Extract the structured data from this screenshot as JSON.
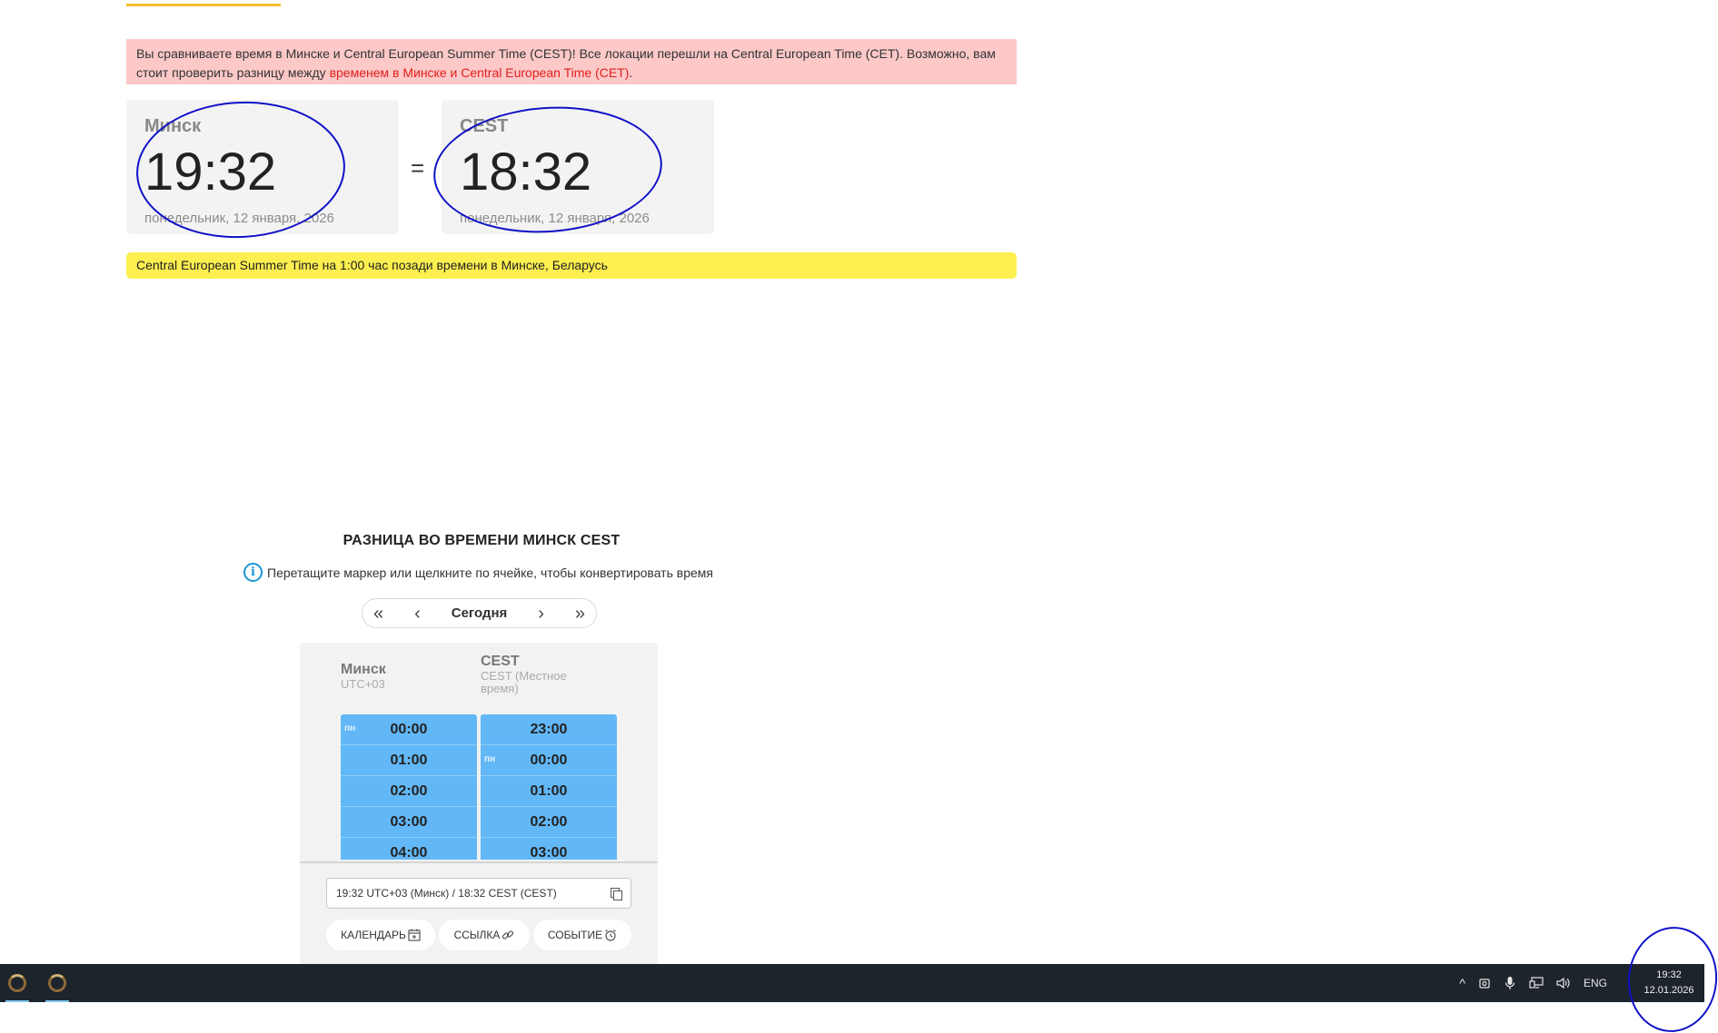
{
  "warning": {
    "text": "Вы сравниваете время в Минске и Central European Summer Time (CEST)! Все локации перешли на Central European Time (CET). Возможно, вам стоит проверить разницу между ",
    "link": "временем в Минске и Central European Time (CET)",
    "tail": "."
  },
  "cards": {
    "left": {
      "city": "Минск",
      "time": "19:32",
      "date": "понедельник, 12 января, 2026"
    },
    "equals": "=",
    "right": {
      "city": "CEST",
      "time": "18:32",
      "date": "понедельник, 12 января, 2026"
    }
  },
  "summary": "Central European Summer Time на 1:00 час позади времени в Минске, Беларусь",
  "converter": {
    "title": "РАЗНИЦА ВО ВРЕМЕНИ МИНСК CEST",
    "hint": "Перетащите маркер или щелкните по ячейке, чтобы конвертировать время",
    "nav": {
      "first": "«",
      "prev": "‹",
      "today": "Сегодня",
      "next": "›",
      "last": "»"
    },
    "col1": {
      "name": "Минск",
      "sub": "UTC+03",
      "cells": [
        {
          "day": "пн",
          "time": "00:00"
        },
        {
          "day": "",
          "time": "01:00"
        },
        {
          "day": "",
          "time": "02:00"
        },
        {
          "day": "",
          "time": "03:00"
        },
        {
          "day": "",
          "time": "04:00"
        }
      ]
    },
    "col2": {
      "name": "CEST",
      "sub": "CEST (Местное время)",
      "cells": [
        {
          "day": "",
          "time": "23:00"
        },
        {
          "day": "пн",
          "time": "00:00"
        },
        {
          "day": "",
          "time": "01:00"
        },
        {
          "day": "",
          "time": "02:00"
        },
        {
          "day": "",
          "time": "03:00"
        }
      ]
    },
    "copy_text": "19:32 UTC+03 (Минск) / 18:32 CEST (CEST)",
    "buttons": {
      "calendar": "КАЛЕНДАРЬ",
      "link": "ССЫЛКА",
      "event": "СОБЫТИЕ"
    }
  },
  "taskbar": {
    "tray_chevron": "^",
    "language": "ENG",
    "clock_time": "19:32",
    "clock_date": "12.01.2026"
  }
}
